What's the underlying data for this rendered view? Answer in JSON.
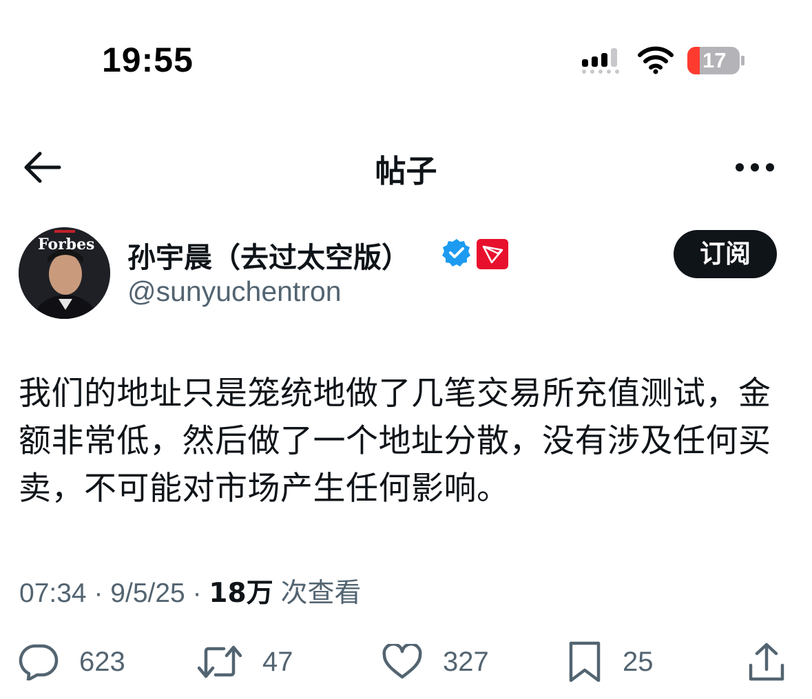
{
  "status_bar": {
    "time": "19:55",
    "battery_level": "17",
    "icons": [
      "signal-icon",
      "wifi-icon",
      "battery-icon"
    ]
  },
  "header": {
    "title": "帖子",
    "icons": [
      "back-arrow-icon",
      "more-icon"
    ]
  },
  "author": {
    "name": "孙宇晨（去过太空版）",
    "handle": "@sunyuchentron",
    "avatar_text": "Forbes",
    "subscribe_label": "订阅",
    "badges": [
      "verified-badge-icon",
      "tron-logo-icon"
    ]
  },
  "post": {
    "text": "我们的地址只是笼统地做了几笔交易所充值测试，金额非常低，然后做了一个地址分散，没有涉及任何买卖，不可能对市场产生任何影响。"
  },
  "meta": {
    "time": "07:34",
    "separator": "·",
    "date": "9/5/25",
    "views_count": "18万",
    "views_label": "次查看"
  },
  "actions": {
    "replies": "623",
    "reposts": "47",
    "likes": "327",
    "bookmarks": "25"
  },
  "colors": {
    "text": "#0f1419",
    "secondary": "#536471",
    "verified": "#1d9bf0",
    "battery_low": "#ff3b30",
    "tron": "#e8112d"
  }
}
